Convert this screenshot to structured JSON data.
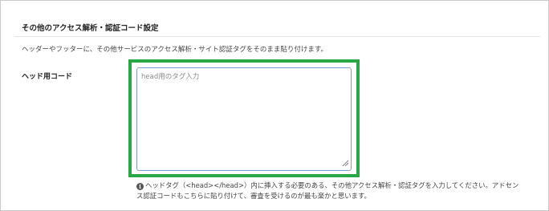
{
  "section": {
    "title": "その他のアクセス解析・認証コード設定",
    "description": "ヘッダーやフッターに、その他サービスのアクセス解析・サイト認証タグをそのまま貼り付けます。"
  },
  "head_code": {
    "label": "ヘッド用コード",
    "placeholder": "head用のタグ入力",
    "value": "",
    "help_icon": "info-circle-icon",
    "help_text_line1": "ヘッドタグ（<head></head>）内に挿入する必要のある、その他アクセス解析・認証タグを入力してください。アドセン",
    "help_text_line2": "ス認証コードもこちらに貼り付けて、審査を受けるのが最も楽かと思います。"
  },
  "colors": {
    "highlight": "#28a745",
    "textarea_border": "#7a9fc7"
  }
}
